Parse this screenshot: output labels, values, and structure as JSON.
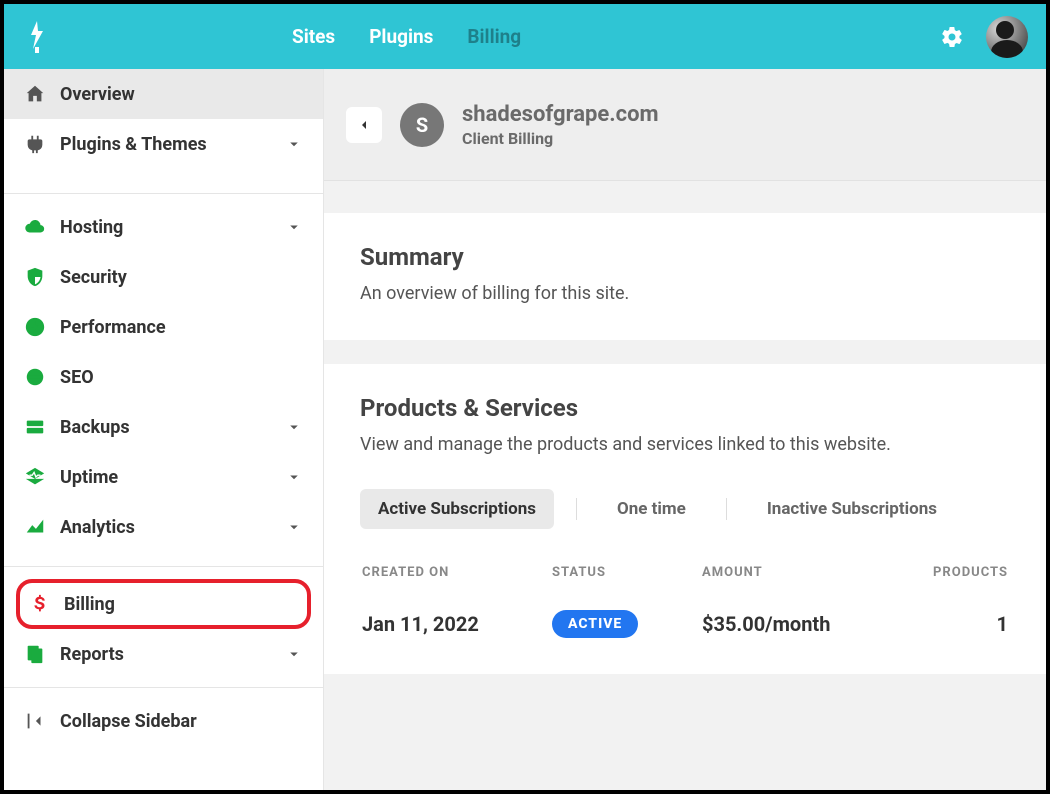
{
  "header": {
    "tabs": [
      {
        "label": "Sites",
        "active": false
      },
      {
        "label": "Plugins",
        "active": false
      },
      {
        "label": "Billing",
        "active": true
      }
    ]
  },
  "sidebar": {
    "items": [
      {
        "label": "Overview",
        "icon": "home-icon",
        "active": true
      },
      {
        "label": "Plugins & Themes",
        "icon": "plug-icon",
        "chevron": true
      },
      {
        "label": "Hosting",
        "icon": "cloud-icon",
        "chevron": true,
        "green": true
      },
      {
        "label": "Security",
        "icon": "shield-icon",
        "green": true
      },
      {
        "label": "Performance",
        "icon": "bolt-icon",
        "green": true
      },
      {
        "label": "SEO",
        "icon": "seo-icon",
        "green": true
      },
      {
        "label": "Backups",
        "icon": "backups-icon",
        "chevron": true,
        "green": true
      },
      {
        "label": "Uptime",
        "icon": "uptime-icon",
        "chevron": true,
        "green": true
      },
      {
        "label": "Analytics",
        "icon": "analytics-icon",
        "chevron": true,
        "green": true
      },
      {
        "label": "Billing",
        "icon": "dollar-icon",
        "highlight": true
      },
      {
        "label": "Reports",
        "icon": "reports-icon",
        "chevron": true,
        "green": true
      },
      {
        "label": "Collapse Sidebar",
        "icon": "collapse-icon"
      }
    ]
  },
  "crumb": {
    "site_initial": "S",
    "site": "shadesofgrape.com",
    "subtitle": "Client Billing"
  },
  "summary": {
    "title": "Summary",
    "subtitle": "An overview of billing for this site."
  },
  "products": {
    "title": "Products & Services",
    "subtitle": "View and manage the products and services linked to this website.",
    "filters": [
      {
        "label": "Active Subscriptions",
        "active": true
      },
      {
        "label": "One time"
      },
      {
        "label": "Inactive Subscriptions"
      }
    ],
    "columns": {
      "created": "Created On",
      "status": "Status",
      "amount": "Amount",
      "products": "Products"
    },
    "rows": [
      {
        "created": "Jan 11, 2022",
        "status": "ACTIVE",
        "amount": "$35.00/month",
        "products": "1"
      }
    ]
  }
}
